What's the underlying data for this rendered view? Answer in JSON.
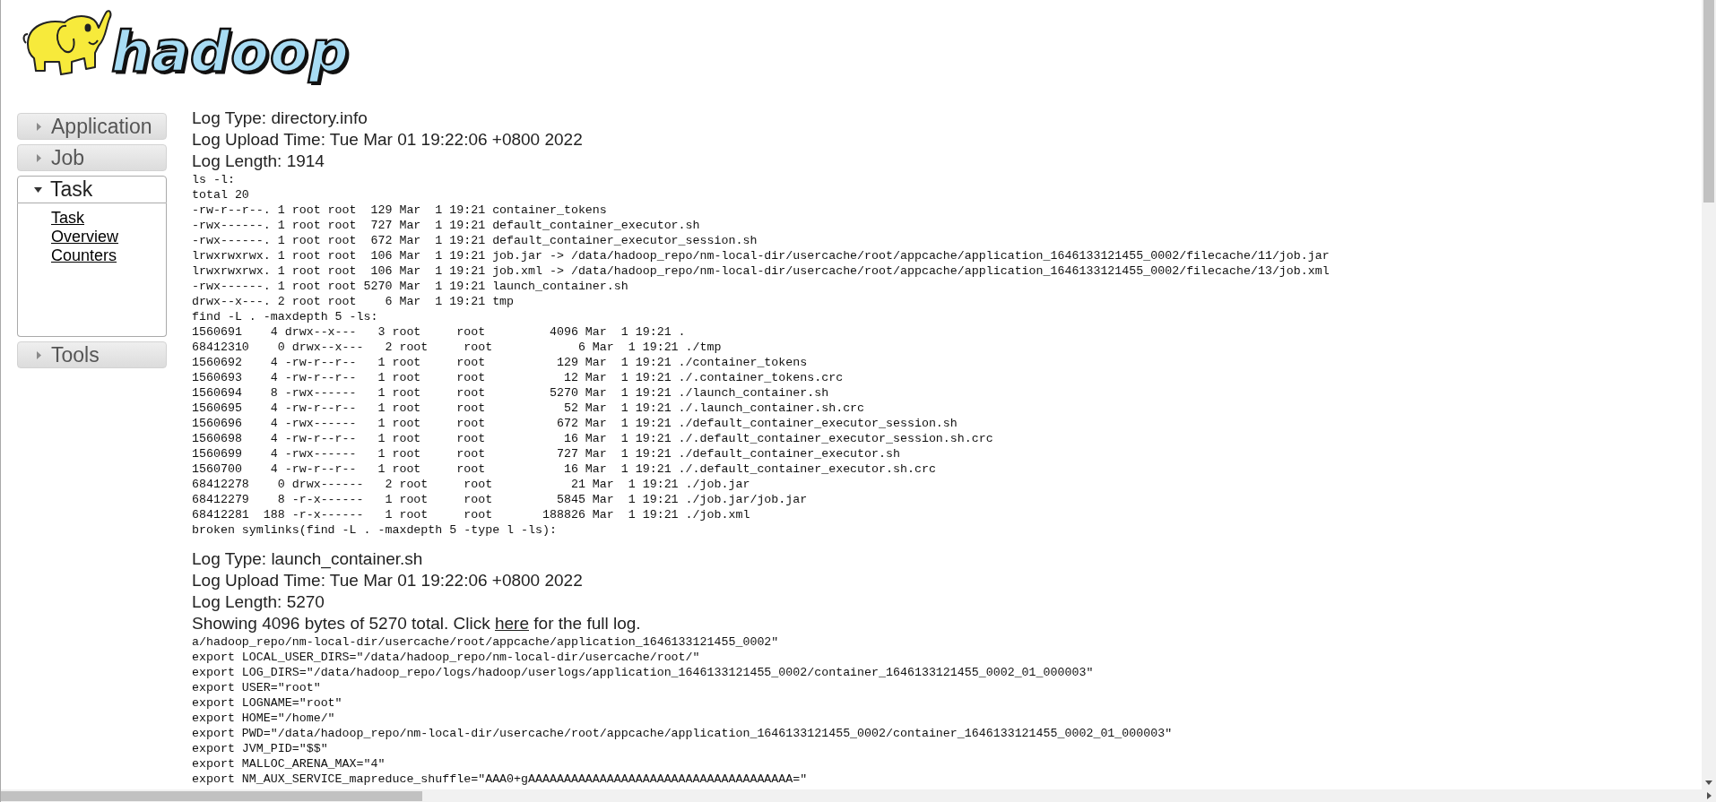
{
  "logo": {
    "text": "hadoop"
  },
  "sidebar": {
    "sections": [
      {
        "label": "Application",
        "expanded": false
      },
      {
        "label": "Job",
        "expanded": false
      },
      {
        "label": "Task",
        "expanded": true,
        "links": [
          "Task",
          "Overview",
          "Counters"
        ]
      },
      {
        "label": "Tools",
        "expanded": false
      }
    ]
  },
  "logs": [
    {
      "type": "Log Type: directory.info",
      "upload_time": "Log Upload Time: Tue Mar 01 19:22:06 +0800 2022",
      "length": "Log Length: 1914",
      "lines": [
        "ls -l:",
        "total 20",
        "-rw-r--r--. 1 root root  129 Mar  1 19:21 container_tokens",
        "-rwx------. 1 root root  727 Mar  1 19:21 default_container_executor.sh",
        "-rwx------. 1 root root  672 Mar  1 19:21 default_container_executor_session.sh",
        "lrwxrwxrwx. 1 root root  106 Mar  1 19:21 job.jar -> /data/hadoop_repo/nm-local-dir/usercache/root/appcache/application_1646133121455_0002/filecache/11/job.jar",
        "lrwxrwxrwx. 1 root root  106 Mar  1 19:21 job.xml -> /data/hadoop_repo/nm-local-dir/usercache/root/appcache/application_1646133121455_0002/filecache/13/job.xml",
        "-rwx------. 1 root root 5270 Mar  1 19:21 launch_container.sh",
        "drwx--x---. 2 root root    6 Mar  1 19:21 tmp",
        "find -L . -maxdepth 5 -ls:",
        "1560691    4 drwx--x---   3 root     root         4096 Mar  1 19:21 .",
        "68412310    0 drwx--x---   2 root     root            6 Mar  1 19:21 ./tmp",
        "1560692    4 -rw-r--r--   1 root     root          129 Mar  1 19:21 ./container_tokens",
        "1560693    4 -rw-r--r--   1 root     root           12 Mar  1 19:21 ./.container_tokens.crc",
        "1560694    8 -rwx------   1 root     root         5270 Mar  1 19:21 ./launch_container.sh",
        "1560695    4 -rw-r--r--   1 root     root           52 Mar  1 19:21 ./.launch_container.sh.crc",
        "1560696    4 -rwx------   1 root     root          672 Mar  1 19:21 ./default_container_executor_session.sh",
        "1560698    4 -rw-r--r--   1 root     root           16 Mar  1 19:21 ./.default_container_executor_session.sh.crc",
        "1560699    4 -rwx------   1 root     root          727 Mar  1 19:21 ./default_container_executor.sh",
        "1560700    4 -rw-r--r--   1 root     root           16 Mar  1 19:21 ./.default_container_executor.sh.crc",
        "68412278    0 drwx------   2 root     root           21 Mar  1 19:21 ./job.jar",
        "68412279    8 -r-x------   1 root     root         5845 Mar  1 19:21 ./job.jar/job.jar",
        "68412281  188 -r-x------   1 root     root       188826 Mar  1 19:21 ./job.xml",
        "broken symlinks(find -L . -maxdepth 5 -type l -ls):"
      ]
    },
    {
      "type": "Log Type: launch_container.sh",
      "upload_time": "Log Upload Time: Tue Mar 01 19:22:06 +0800 2022",
      "length": "Log Length: 5270",
      "notice": {
        "before": "Showing 4096 bytes of 5270 total. Click ",
        "link": "here",
        "after": " for the full log."
      },
      "lines": [
        "a/hadoop_repo/nm-local-dir/usercache/root/appcache/application_1646133121455_0002\"",
        "export LOCAL_USER_DIRS=\"/data/hadoop_repo/nm-local-dir/usercache/root/\"",
        "export LOG_DIRS=\"/data/hadoop_repo/logs/hadoop/userlogs/application_1646133121455_0002/container_1646133121455_0002_01_000003\"",
        "export USER=\"root\"",
        "export LOGNAME=\"root\"",
        "export HOME=\"/home/\"",
        "export PWD=\"/data/hadoop_repo/nm-local-dir/usercache/root/appcache/application_1646133121455_0002/container_1646133121455_0002_01_000003\"",
        "export JVM_PID=\"$$\"",
        "export MALLOC_ARENA_MAX=\"4\"",
        "export NM_AUX_SERVICE_mapreduce_shuffle=\"AAA0+gAAAAAAAAAAAAAAAAAAAAAAAAAAAAAAAAAAAAA=\""
      ]
    }
  ]
}
